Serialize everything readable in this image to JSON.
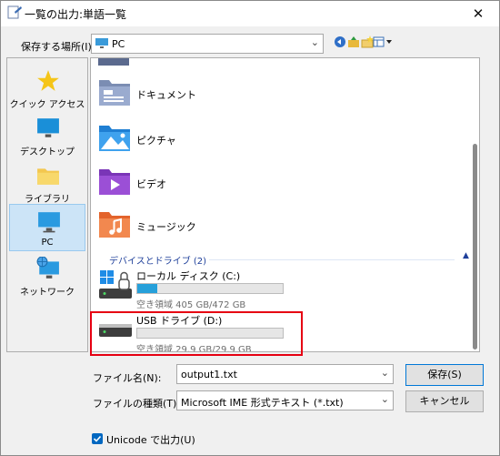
{
  "window": {
    "title": "一覧の出力:単語一覧",
    "close_glyph": "✕"
  },
  "location": {
    "label": "保存する場所(I):",
    "value": "PC"
  },
  "places": [
    {
      "label": "クイック アクセス",
      "icon": "star-icon"
    },
    {
      "label": "デスクトップ",
      "icon": "desktop-icon"
    },
    {
      "label": "ライブラリ",
      "icon": "library-icon"
    },
    {
      "label": "PC",
      "icon": "pc-icon",
      "selected": true
    },
    {
      "label": "ネットワーク",
      "icon": "network-icon"
    }
  ],
  "folders": [
    {
      "label": "ドキュメント",
      "icon": "documents-folder-icon"
    },
    {
      "label": "ピクチャ",
      "icon": "pictures-folder-icon"
    },
    {
      "label": "ビデオ",
      "icon": "videos-folder-icon"
    },
    {
      "label": "ミュージック",
      "icon": "music-folder-icon"
    }
  ],
  "devices_group": {
    "label": "デバイスとドライブ (2)"
  },
  "drives": [
    {
      "name": "ローカル ディスク (C:)",
      "free": "空き領域 405 GB/472 GB",
      "used_fraction": 0.14,
      "icon": "system-drive-icon"
    },
    {
      "name": "USB ドライブ (D:)",
      "free": "空き領域 29.9 GB/29.9 GB",
      "used_fraction": 0.0,
      "icon": "usb-drive-icon"
    }
  ],
  "filename": {
    "label": "ファイル名(N):",
    "value": "output1.txt"
  },
  "filetype": {
    "label": "ファイルの種類(T):",
    "value": "Microsoft IME 形式テキスト (*.txt)"
  },
  "buttons": {
    "save": "保存(S)",
    "cancel": "キャンセル"
  },
  "unicode": {
    "label": "Unicode で出力(U)",
    "checked": true
  },
  "colors": {
    "accent": "#0078d7",
    "highlight": "#e60012",
    "drive_fill": "#26a0da"
  }
}
